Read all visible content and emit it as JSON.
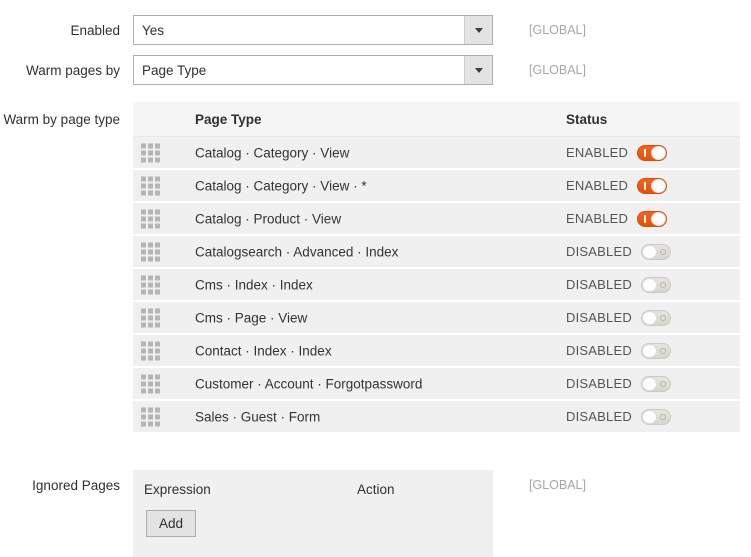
{
  "fields": {
    "enabled": {
      "label": "Enabled",
      "value": "Yes",
      "scope": "[GLOBAL]"
    },
    "warm_pages_by": {
      "label": "Warm pages by",
      "value": "Page Type",
      "scope": "[GLOBAL]"
    }
  },
  "warm_by_page_type": {
    "label": "Warm by page type",
    "columns": {
      "page_type": "Page Type",
      "status": "Status"
    },
    "rows": [
      {
        "page_type": "Catalog · Category · View",
        "status_text": "ENABLED",
        "enabled": true
      },
      {
        "page_type": "Catalog · Category · View · *",
        "status_text": "ENABLED",
        "enabled": true
      },
      {
        "page_type": "Catalog · Product · View",
        "status_text": "ENABLED",
        "enabled": true
      },
      {
        "page_type": "Catalogsearch · Advanced · Index",
        "status_text": "DISABLED",
        "enabled": false
      },
      {
        "page_type": "Cms · Index · Index",
        "status_text": "DISABLED",
        "enabled": false
      },
      {
        "page_type": "Cms · Page · View",
        "status_text": "DISABLED",
        "enabled": false
      },
      {
        "page_type": "Contact · Index · Index",
        "status_text": "DISABLED",
        "enabled": false
      },
      {
        "page_type": "Customer · Account · Forgotpassword",
        "status_text": "DISABLED",
        "enabled": false
      },
      {
        "page_type": "Sales · Guest · Form",
        "status_text": "DISABLED",
        "enabled": false
      }
    ]
  },
  "ignored_pages": {
    "label": "Ignored Pages",
    "columns": {
      "expression": "Expression",
      "action": "Action"
    },
    "add_label": "Add",
    "scope": "[GLOBAL]"
  },
  "colors": {
    "toggle_on": "#eb5202",
    "toggle_off": "#dedede",
    "table_row": "#f0f0f0",
    "table_header": "#f5f5f5",
    "scope_text": "#a6a6a6"
  }
}
